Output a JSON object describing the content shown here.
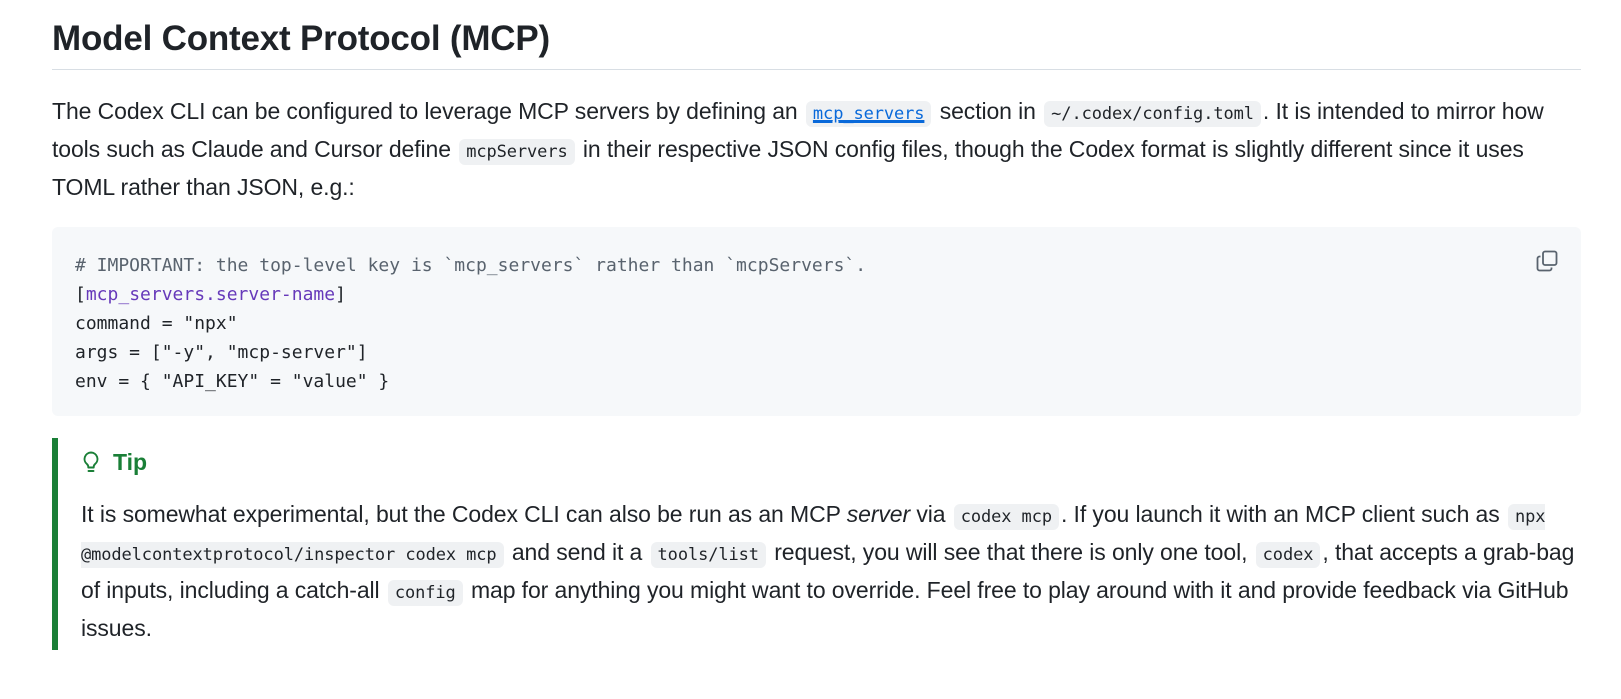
{
  "heading": "Model Context Protocol (MCP)",
  "intro": {
    "t1": "The Codex CLI can be configured to leverage MCP servers by defining an",
    "link_code": "mcp_servers",
    "t2": "section in",
    "code_path": "~/.codex/config.toml",
    "t3": ". It is intended to mirror how tools such as Claude and Cursor define",
    "code_mcpservers": "mcpServers",
    "t4": "in their respective JSON config files, though the Codex format is slightly different since it uses TOML rather than JSON, e.g.:"
  },
  "code": {
    "comment": "# IMPORTANT: the top-level key is `mcp_servers` rather than `mcpServers`.",
    "section_open": "[",
    "section_name": "mcp_servers.server-name",
    "section_close": "]",
    "line_command": "command = \"npx\"",
    "line_args": "args = [\"-y\", \"mcp-server\"]",
    "line_env": "env = { \"API_KEY\" = \"value\" }",
    "copy_icon": "copy-icon"
  },
  "tip": {
    "icon": "lightbulb-icon",
    "title": "Tip",
    "b1": "It is somewhat experimental, but the Codex CLI can also be run as an MCP",
    "b_em": "server",
    "b2": "via",
    "code_codex_mcp": "codex mcp",
    "b3": ". If you launch it with an MCP client such as",
    "code_npx": "npx @modelcontextprotocol/inspector codex mcp",
    "b4": "and send it a",
    "code_tools_list": "tools/list",
    "b5": "request, you will see that there is only one tool,",
    "code_codex": "codex",
    "b6": ", that accepts a grab-bag of inputs, including a catch-all",
    "code_config": "config",
    "b7": "map for anything you might want to override. Feel free to play around with it and provide feedback via GitHub issues."
  },
  "colors": {
    "tip_accent": "#1a7f37",
    "link": "#0969da",
    "code_bg": "#f6f8fa",
    "inline_code_bg": "#eff1f3"
  }
}
